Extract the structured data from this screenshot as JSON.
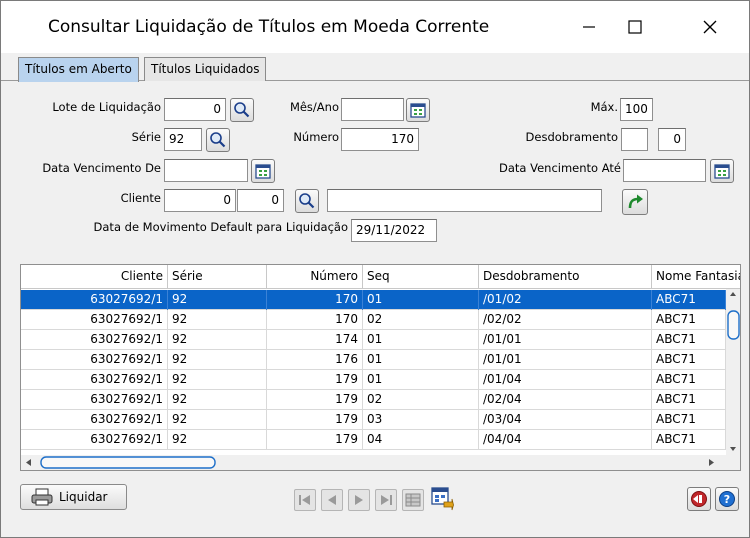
{
  "window": {
    "title": "Consultar Liquidação de Títulos em Moeda Corrente"
  },
  "tabs": [
    {
      "label": "Títulos em Aberto",
      "active": true
    },
    {
      "label": "Títulos Liquidados",
      "active": false
    }
  ],
  "form": {
    "lote_label": "Lote de Liquidação",
    "lote_value": "0",
    "mes_ano_label": "Mês/Ano",
    "mes_ano_value": "",
    "max_label": "Máx.",
    "max_value": "100",
    "serie_label": "Série",
    "serie_value": "92",
    "numero_label": "Número",
    "numero_value": "170",
    "desdobramento_label": "Desdobramento",
    "desdobramento_value1": "",
    "desdobramento_value2": "0",
    "data_venc_de_label": "Data Vencimento De",
    "data_venc_de_value": "",
    "data_venc_ate_label": "Data Vencimento  Até",
    "data_venc_ate_value": "",
    "cliente_label": "Cliente",
    "cliente_value1": "0",
    "cliente_value2": "0",
    "cliente_name_value": "",
    "data_mov_label": "Data de Movimento Default para Liquidação",
    "data_mov_value": "29/11/2022"
  },
  "grid": {
    "columns": [
      "Cliente",
      "Série",
      "Número",
      "Seq",
      "Desdobramento",
      "Nome Fantasia"
    ],
    "rows": [
      {
        "cliente": "63027692/1",
        "serie": "92",
        "numero": "170",
        "seq": "01",
        "desdobramento": "/01/02",
        "nome": "ABC71",
        "selected": true
      },
      {
        "cliente": "63027692/1",
        "serie": "92",
        "numero": "170",
        "seq": "02",
        "desdobramento": "/02/02",
        "nome": "ABC71",
        "selected": false
      },
      {
        "cliente": "63027692/1",
        "serie": "92",
        "numero": "174",
        "seq": "01",
        "desdobramento": "/01/01",
        "nome": "ABC71",
        "selected": false
      },
      {
        "cliente": "63027692/1",
        "serie": "92",
        "numero": "176",
        "seq": "01",
        "desdobramento": "/01/01",
        "nome": "ABC71",
        "selected": false
      },
      {
        "cliente": "63027692/1",
        "serie": "92",
        "numero": "179",
        "seq": "01",
        "desdobramento": "/01/04",
        "nome": "ABC71",
        "selected": false
      },
      {
        "cliente": "63027692/1",
        "serie": "92",
        "numero": "179",
        "seq": "02",
        "desdobramento": "/02/04",
        "nome": "ABC71",
        "selected": false
      },
      {
        "cliente": "63027692/1",
        "serie": "92",
        "numero": "179",
        "seq": "03",
        "desdobramento": "/03/04",
        "nome": "ABC71",
        "selected": false
      },
      {
        "cliente": "63027692/1",
        "serie": "92",
        "numero": "179",
        "seq": "04",
        "desdobramento": "/04/04",
        "nome": "ABC71",
        "selected": false
      }
    ]
  },
  "footer": {
    "liquidar_label": "Liquidar"
  },
  "icons": {
    "search": "magnifier-icon",
    "calendar": "calendar-icon",
    "refresh": "green-arrow-icon",
    "print": "printer-icon",
    "exit": "exit-icon",
    "help": "help-icon"
  },
  "colors": {
    "selection": "#0a64c8",
    "tab_active": "#b9d3ee",
    "exit_red": "#c0262a",
    "help_blue": "#1f6fd1"
  }
}
